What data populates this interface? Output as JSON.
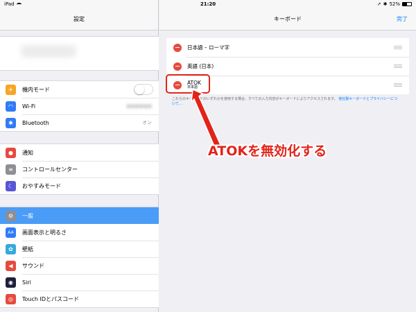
{
  "status": {
    "device": "iPad",
    "time": "21:20",
    "battery": "52%",
    "battery_level": 0.52
  },
  "sidebar": {
    "title": "設定",
    "groups": [
      {
        "items": [
          {
            "label": "機内モード",
            "icon": "airplane-icon",
            "color": "#f5a623",
            "toggle": false
          },
          {
            "label": "Wi-Fi",
            "icon": "wifi-icon",
            "color": "#2f7cf6",
            "value": "●●●●●●"
          },
          {
            "label": "Bluetooth",
            "icon": "bluetooth-icon",
            "color": "#2f7cf6",
            "value": "オン"
          }
        ]
      },
      {
        "items": [
          {
            "label": "通知",
            "icon": "notifications-icon",
            "color": "#e54b3d"
          },
          {
            "label": "コントロールセンター",
            "icon": "control-center-icon",
            "color": "#8e8e93"
          },
          {
            "label": "おやすみモード",
            "icon": "moon-icon",
            "color": "#5856d6"
          }
        ]
      },
      {
        "items": [
          {
            "label": "一般",
            "icon": "gear-icon",
            "color": "#8e8e93",
            "selected": true
          },
          {
            "label": "画面表示と明るさ",
            "icon": "display-icon",
            "color": "#2f7cf6"
          },
          {
            "label": "壁紙",
            "icon": "wallpaper-icon",
            "color": "#34aadc"
          },
          {
            "label": "サウンド",
            "icon": "sound-icon",
            "color": "#e54b3d"
          },
          {
            "label": "Siri",
            "icon": "siri-icon",
            "color": "#1f1f3a"
          },
          {
            "label": "Touch IDとパスコード",
            "icon": "fingerprint-icon",
            "color": "#e54b3d"
          }
        ]
      }
    ]
  },
  "main": {
    "title": "キーボード",
    "done_label": "完了",
    "keyboards": [
      {
        "name": "日本語 – ローマ字"
      },
      {
        "name": "英語 (日本)"
      },
      {
        "name": "ATOK",
        "sub": "日本語"
      }
    ],
    "footnote_text": "これらのキーボードのいずれかを使用する場合、すべての入力内容がキーボードによりアクセスされます。",
    "footnote_link": "他社製キーボードとプライバシーについて…"
  },
  "annotation": {
    "callout": "ATOKを無効化する",
    "color": "#e2231a"
  }
}
